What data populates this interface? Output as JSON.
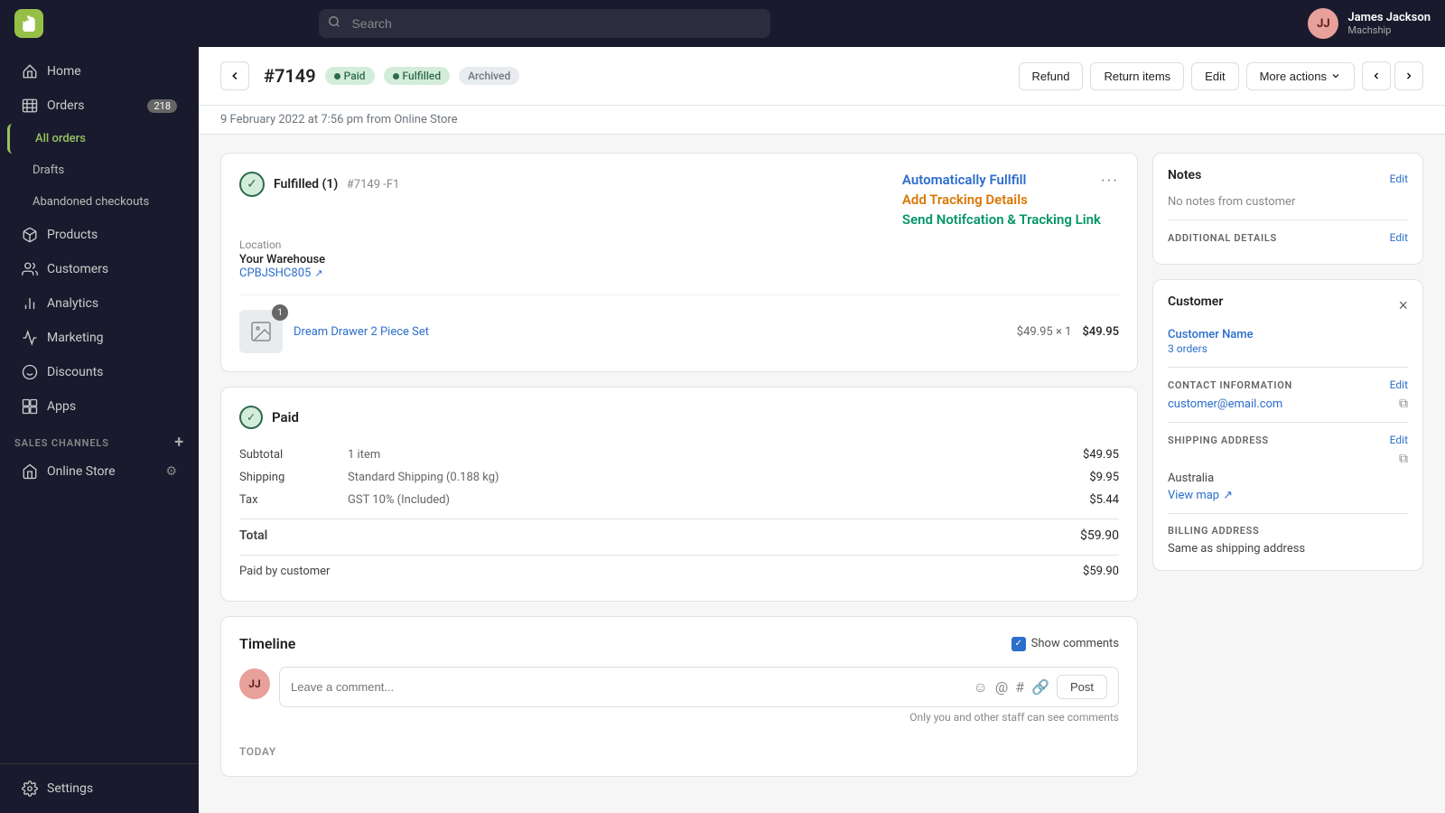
{
  "topnav": {
    "search_placeholder": "Search",
    "logo_text": "S",
    "user": {
      "name": "James Jackson",
      "store": "Machship",
      "initials": "JJ"
    }
  },
  "sidebar": {
    "nav_items": [
      {
        "id": "home",
        "label": "Home",
        "icon": "home"
      },
      {
        "id": "orders",
        "label": "Orders",
        "icon": "orders",
        "badge": "218"
      },
      {
        "id": "all-orders",
        "label": "All orders",
        "icon": "",
        "sub": true,
        "active": true
      },
      {
        "id": "drafts",
        "label": "Drafts",
        "icon": "",
        "sub": true
      },
      {
        "id": "abandoned",
        "label": "Abandoned checkouts",
        "icon": "",
        "sub": true
      },
      {
        "id": "products",
        "label": "Products",
        "icon": "products"
      },
      {
        "id": "customers",
        "label": "Customers",
        "icon": "customers"
      },
      {
        "id": "analytics",
        "label": "Analytics",
        "icon": "analytics"
      },
      {
        "id": "marketing",
        "label": "Marketing",
        "icon": "marketing"
      },
      {
        "id": "discounts",
        "label": "Discounts",
        "icon": "discounts"
      },
      {
        "id": "apps",
        "label": "Apps",
        "icon": "apps"
      }
    ],
    "sales_channels_title": "SALES CHANNELS",
    "sales_channels": [
      {
        "id": "online-store",
        "label": "Online Store",
        "icon": "store"
      }
    ],
    "settings_label": "Settings"
  },
  "order": {
    "number": "#7149",
    "badges": {
      "paid": "Paid",
      "fulfilled": "Fulfilled",
      "archived": "Archived"
    },
    "meta": "9 February 2022 at 7:56 pm from Online Store",
    "actions": {
      "refund": "Refund",
      "return_items": "Return items",
      "edit": "Edit",
      "more_actions": "More actions"
    }
  },
  "fulfillment_card": {
    "title": "Fulfilled (1)",
    "order_ref": "#7149 -F1",
    "location_label": "Location",
    "location_value": "Your Warehouse",
    "tracking_code": "CPBJSHC805",
    "action1": "Automatically Fullfill",
    "action2": "Add Tracking Details",
    "action3": "Send Notifcation & Tracking Link",
    "product": {
      "name": "Dream Drawer 2 Piece Set",
      "quantity": 1,
      "count_badge": "1",
      "unit_price": "$49.95",
      "multiplier": "× 1",
      "total": "$49.95"
    }
  },
  "payment_card": {
    "status": "Paid",
    "lines": [
      {
        "label": "Subtotal",
        "mid": "1 item",
        "value": "$49.95"
      },
      {
        "label": "Shipping",
        "mid": "Standard Shipping (0.188 kg)",
        "value": "$9.95"
      },
      {
        "label": "Tax",
        "mid": "GST 10% (Included)",
        "value": "$5.44"
      }
    ],
    "total_label": "Total",
    "total_value": "$59.90",
    "paid_by_label": "Paid by customer",
    "paid_by_value": "$59.90"
  },
  "timeline": {
    "title": "Timeline",
    "show_comments_label": "Show comments",
    "comment_placeholder": "Leave a comment...",
    "post_button": "Post",
    "comment_note": "Only you and other staff can see comments",
    "today_label": "TODAY",
    "user_initials": "JJ"
  },
  "notes_card": {
    "title": "Notes",
    "edit_label": "Edit",
    "no_notes": "No notes from customer",
    "additional_details_label": "ADDITIONAL DETAILS",
    "additional_details_edit": "Edit"
  },
  "customer_card": {
    "title": "Customer",
    "customer_name": "Customer Name",
    "orders_count": "3 orders",
    "contact_label": "CONTACT INFORMATION",
    "contact_edit": "Edit",
    "email": "customer@email.com",
    "shipping_label": "SHIPPING ADDRESS",
    "shipping_edit": "Edit",
    "country": "Australia",
    "view_map": "View map",
    "billing_label": "BILLING ADDRESS",
    "billing_value": "Same as shipping address"
  }
}
